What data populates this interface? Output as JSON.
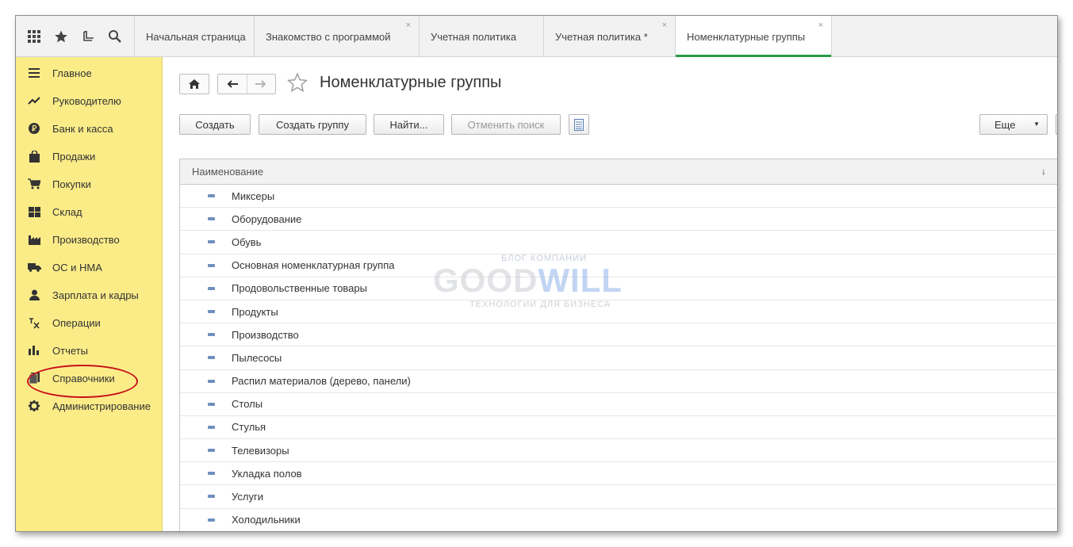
{
  "quick_access": {
    "icons": [
      "apps-grid-icon",
      "favorites-star-icon",
      "history-icon",
      "search-icon"
    ]
  },
  "tabs": [
    {
      "label": "Начальная страница",
      "closable": false,
      "active": false
    },
    {
      "label": "Знакомство с программой",
      "closable": true,
      "active": false
    },
    {
      "label": "Учетная политика",
      "closable": false,
      "active": false
    },
    {
      "label": "Учетная политика *",
      "closable": true,
      "active": false
    },
    {
      "label": "Номенклатурные группы",
      "closable": true,
      "active": true
    }
  ],
  "tab_close_glyph": "×",
  "sidebar": {
    "items": [
      {
        "label": "Главное",
        "icon": "menu-lines-icon"
      },
      {
        "label": "Руководителю",
        "icon": "trend-chart-icon"
      },
      {
        "label": "Банк и касса",
        "icon": "ruble-coin-icon"
      },
      {
        "label": "Продажи",
        "icon": "shopping-bag-icon"
      },
      {
        "label": "Покупки",
        "icon": "cart-icon"
      },
      {
        "label": "Склад",
        "icon": "warehouse-icon"
      },
      {
        "label": "Производство",
        "icon": "factory-icon"
      },
      {
        "label": "ОС и НМА",
        "icon": "truck-icon"
      },
      {
        "label": "Зарплата и кадры",
        "icon": "person-icon"
      },
      {
        "label": "Операции",
        "icon": "operations-icon"
      },
      {
        "label": "Отчеты",
        "icon": "bar-chart-icon"
      },
      {
        "label": "Справочники",
        "icon": "book-icon"
      },
      {
        "label": "Администрирование",
        "icon": "gear-icon"
      }
    ],
    "highlighted": "Справочники"
  },
  "page": {
    "title": "Номенклатурные группы"
  },
  "toolbar": {
    "create": "Создать",
    "create_group": "Создать группу",
    "find": "Найти...",
    "cancel_search": "Отменить поиск",
    "more": "Еще",
    "more_arrow": "▼"
  },
  "table": {
    "column": "Наименование",
    "sort_glyph": "↓",
    "rows": [
      "Миксеры",
      "Оборудование",
      "Обувь",
      "Основная номенклатурная группа",
      "Продовольственные товары",
      "Продукты",
      "Производство",
      "Пылесосы",
      "Распил материалов (дерево, панели)",
      "Столы",
      "Стулья",
      "Телевизоры",
      "Укладка полов",
      "Услуги",
      "Холодильники"
    ]
  },
  "watermark": {
    "top": "БЛОГ КОМПАНИИ",
    "brand_part1": "GOOD",
    "brand_part2": "WILL",
    "bottom": "ТЕХНОЛОГИИ ДЛЯ БИЗНЕСА"
  },
  "colors": {
    "sidebar_bg": "#fbec88",
    "active_tab_accent": "#2a9a48",
    "highlight_circle": "#c8111a"
  }
}
